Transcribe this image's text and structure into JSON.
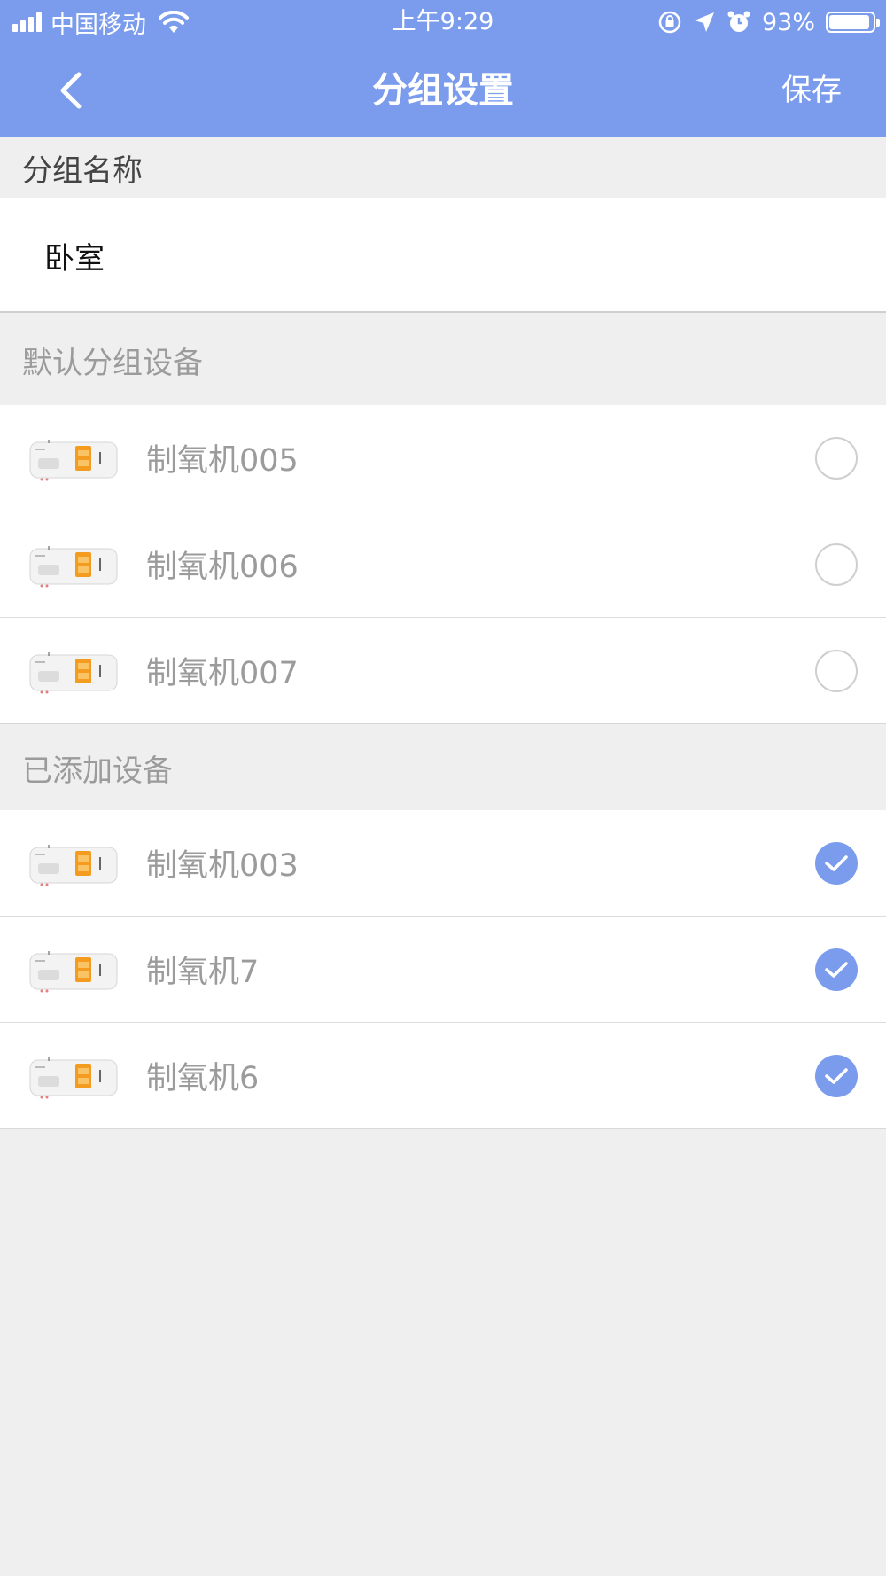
{
  "status_bar": {
    "carrier": "中国移动",
    "time": "上午9:29",
    "battery": "93%",
    "battery_level": 0.93
  },
  "nav": {
    "title": "分组设置",
    "save_label": "保存",
    "back_icon": "chevron-left-icon"
  },
  "group_name": {
    "header": "分组名称",
    "value": "卧室"
  },
  "default_devices": {
    "header": "默认分组设备",
    "items": [
      {
        "name": "制氧机005",
        "checked": false
      },
      {
        "name": "制氧机006",
        "checked": false
      },
      {
        "name": "制氧机007",
        "checked": false
      }
    ]
  },
  "added_devices": {
    "header": "已添加设备",
    "items": [
      {
        "name": "制氧机003",
        "checked": true
      },
      {
        "name": "制氧机7",
        "checked": true
      },
      {
        "name": "制氧机6",
        "checked": true
      }
    ]
  },
  "colors": {
    "accent": "#7b9ced",
    "background": "#efefef",
    "device_display": "#f39c1f"
  }
}
